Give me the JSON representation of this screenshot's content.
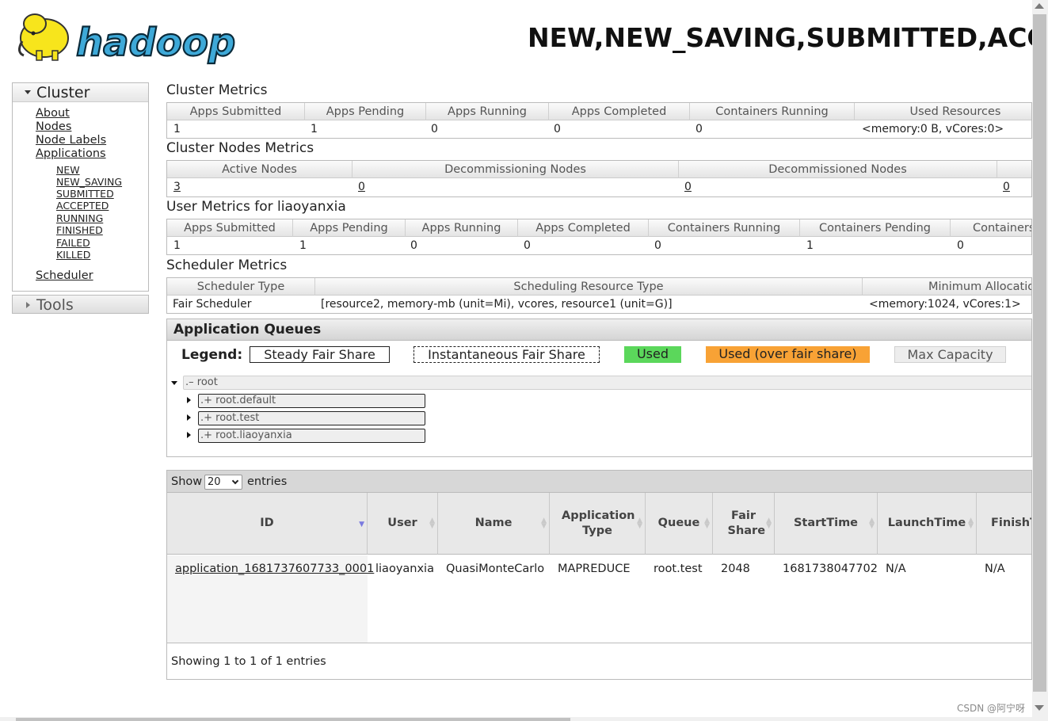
{
  "header": {
    "title": "NEW,NEW_SAVING,SUBMITTED,ACCEPTED,RUNNING,FINISHED,FAILED,KILLED Applications",
    "logo_text": "hadoop"
  },
  "sidebar": {
    "cluster": {
      "label": "Cluster",
      "links": [
        "About",
        "Nodes",
        "Node Labels",
        "Applications"
      ],
      "app_states": [
        "NEW",
        "NEW_SAVING",
        "SUBMITTED",
        "ACCEPTED",
        "RUNNING",
        "FINISHED",
        "FAILED",
        "KILLED"
      ],
      "scheduler": "Scheduler"
    },
    "tools": {
      "label": "Tools"
    }
  },
  "cluster_metrics": {
    "title": "Cluster Metrics",
    "headers": [
      "Apps Submitted",
      "Apps Pending",
      "Apps Running",
      "Apps Completed",
      "Containers Running",
      "Used Resources"
    ],
    "values": [
      "1",
      "1",
      "0",
      "0",
      "0",
      "<memory:0 B, vCores:0>"
    ]
  },
  "cluster_nodes_metrics": {
    "title": "Cluster Nodes Metrics",
    "headers": [
      "Active Nodes",
      "Decommissioning Nodes",
      "Decommissioned Nodes"
    ],
    "values": [
      "3",
      "0",
      "0",
      "0"
    ]
  },
  "user_metrics": {
    "title": "User Metrics for liaoyanxia",
    "headers": [
      "Apps Submitted",
      "Apps Pending",
      "Apps Running",
      "Apps Completed",
      "Containers Running",
      "Containers Pending",
      "Containers"
    ],
    "values": [
      "1",
      "1",
      "0",
      "0",
      "0",
      "1",
      "0"
    ]
  },
  "scheduler_metrics": {
    "title": "Scheduler Metrics",
    "headers": [
      "Scheduler Type",
      "Scheduling Resource Type",
      "Minimum Allocation"
    ],
    "values": [
      "Fair Scheduler",
      "[resource2, memory-mb (unit=Mi), vcores, resource1 (unit=G)]",
      "<memory:1024, vCores:1>"
    ]
  },
  "queues": {
    "title": "Application Queues",
    "legend_label": "Legend:",
    "legend": [
      "Steady Fair Share",
      "Instantaneous Fair Share",
      "Used",
      "Used (over fair share)",
      "Max Capacity"
    ],
    "colors": {
      "used": "#5bd75b",
      "over": "#f8a235",
      "max": "#ededed"
    },
    "root": ".– root",
    "children": [
      ".+ root.default",
      ".+ root.test",
      ".+ root.liaoyanxia"
    ]
  },
  "apps_table": {
    "show_label": "Show",
    "show_value": "20",
    "entries_label": "entries",
    "columns": [
      "ID",
      "User",
      "Name",
      "Application Type",
      "Queue",
      "Fair Share",
      "StartTime",
      "LaunchTime",
      "FinishTime"
    ],
    "row": [
      "application_1681737607733_0001",
      "liaoyanxia",
      "QuasiMonteCarlo",
      "MAPREDUCE",
      "root.test",
      "2048",
      "1681738047702",
      "N/A",
      "N/A"
    ],
    "info": "Showing 1 to 1 of 1 entries"
  },
  "watermark": "CSDN @阿宁呀"
}
